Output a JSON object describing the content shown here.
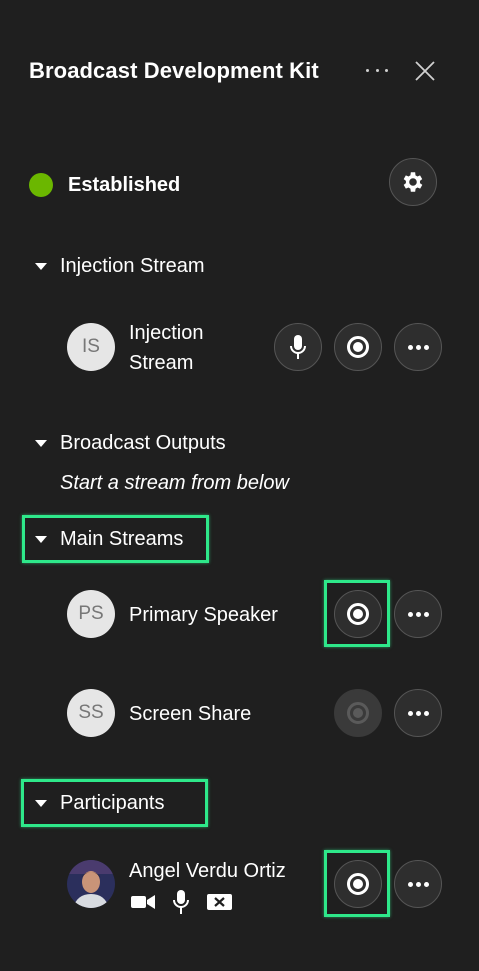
{
  "header": {
    "title": "Broadcast Development Kit"
  },
  "status": {
    "label": "Established",
    "color": "#6bb700"
  },
  "sections": {
    "injection": {
      "title": "Injection Stream"
    },
    "outputs": {
      "title": "Broadcast Outputs",
      "hint": "Start a stream from below"
    },
    "main_streams": {
      "title": "Main Streams"
    },
    "participants": {
      "title": "Participants"
    }
  },
  "injection_item": {
    "initials": "IS",
    "name_line1": "Injection",
    "name_line2": "Stream"
  },
  "main_items": [
    {
      "initials": "PS",
      "name": "Primary Speaker",
      "record_enabled": true
    },
    {
      "initials": "SS",
      "name": "Screen Share",
      "record_enabled": false
    }
  ],
  "participant": {
    "name": "Angel Verdu Ortiz",
    "icons": [
      "video-camera-icon",
      "microphone-icon",
      "screen-share-off-icon"
    ]
  },
  "colors": {
    "background": "#1f1f1f",
    "highlight": "#2ee88a",
    "button": "#2e2e2e"
  }
}
